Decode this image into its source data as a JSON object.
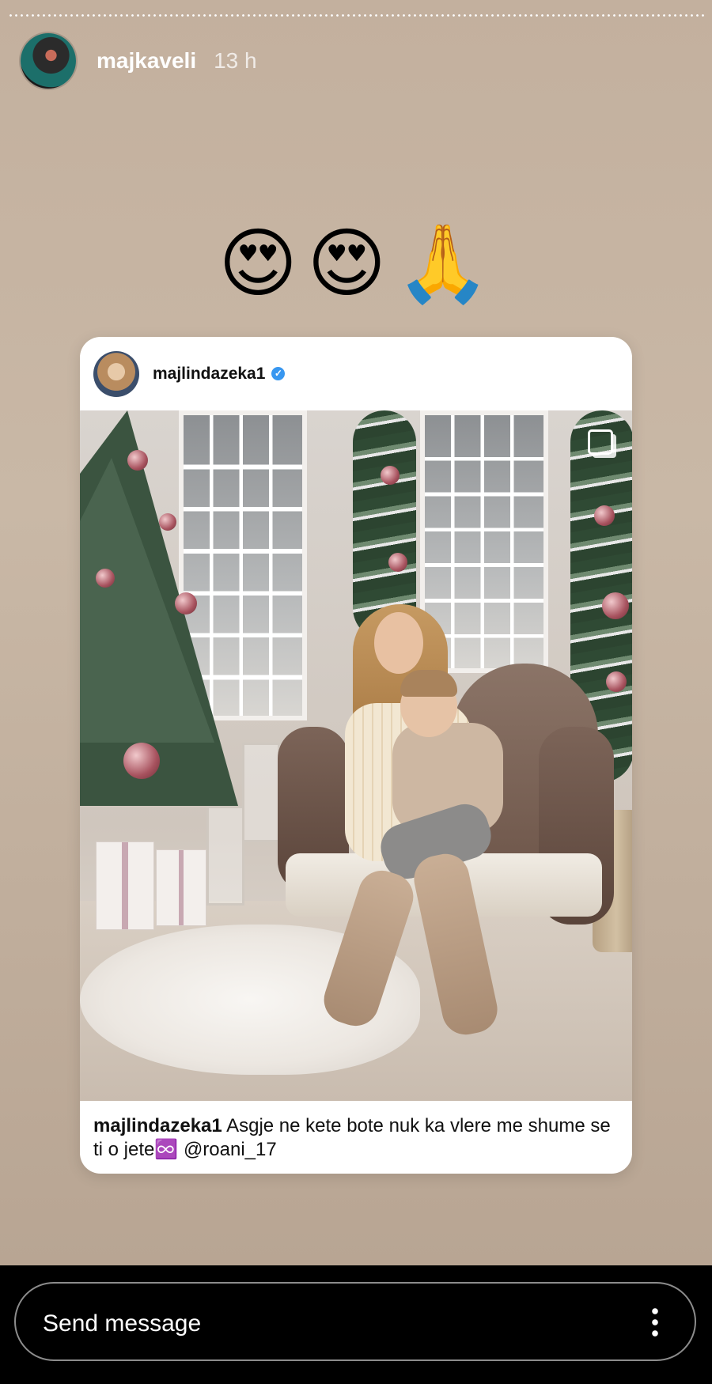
{
  "story": {
    "username": "majkaveli",
    "time": "13 h",
    "emojis": [
      "😍",
      "😍",
      "🙏"
    ]
  },
  "shared_post": {
    "username": "majlindazeka1",
    "verified": true,
    "caption_user": "majlindazeka1",
    "caption_text": "Asgje ne kete bote nuk ka vlere me shume se ti o jete♾️ ",
    "caption_mention": "@roani_17"
  },
  "composer": {
    "placeholder": "Send message"
  },
  "icons": {
    "avatar": "profile-avatar",
    "verified": "verified-badge-icon",
    "multi": "carousel-multiple-icon",
    "more": "more-vertical-icon"
  },
  "colors": {
    "story_bg": "#c3b09e",
    "verified": "#3897f0",
    "bar": "#000000"
  }
}
